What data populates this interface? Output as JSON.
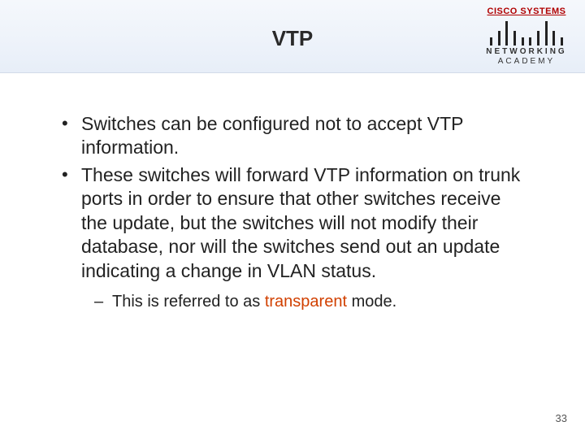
{
  "header": {
    "title": "VTP",
    "logo": {
      "brand": "CISCO SYSTEMS",
      "line1": "NETWORKING",
      "line2": "ACADEMY"
    }
  },
  "bullets": {
    "b1": "Switches can be configured not to accept VTP information.",
    "b2": "These switches will forward VTP information on trunk ports in order to ensure that other switches receive the update, but the switches will not modify their database, nor will the switches send out an update indicating a change in VLAN status.",
    "sub1_prefix": "This is referred to as ",
    "sub1_highlight": "transparent",
    "sub1_suffix": " mode."
  },
  "page": "33"
}
